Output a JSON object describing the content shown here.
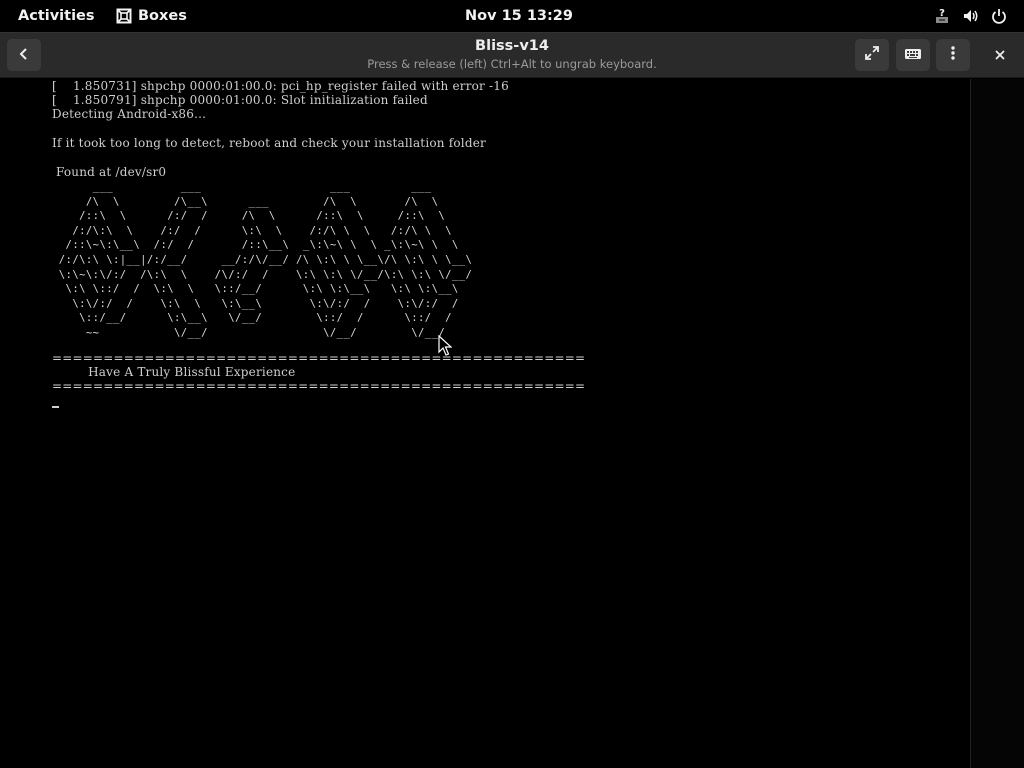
{
  "topbar": {
    "activities": "Activities",
    "app_name": "Boxes",
    "clock": "Nov 15  13:29",
    "icons": [
      "network-unknown-icon",
      "volume-icon",
      "power-icon"
    ]
  },
  "header": {
    "title": "Bliss-v14",
    "subtitle": "Press & release (left) Ctrl+Alt to ungrab keyboard.",
    "buttons": [
      "back-icon",
      "fullscreen-icon",
      "keyboard-icon",
      "menu-dots-icon",
      "close-icon"
    ]
  },
  "console": {
    "lines": [
      "[    1.850731] shpchp 0000:01:00.0: pci_hp_register failed with error -16",
      "[    1.850791] shpchp 0000:01:00.0: Slot initialization failed",
      "Detecting Android-x86...",
      "If it took too long to detect, reboot and check your installation folder",
      " Found at /dev/sr0",
      "====================================================",
      "         Have A Truly Blissful Experience",
      "===================================================="
    ],
    "ascii_art": "      ___          ___                   ___         ___\n     /\\  \\        /\\__\\      ___        /\\  \\       /\\  \\\n    /::\\  \\      /:/  /     /\\  \\      /::\\  \\     /::\\  \\\n   /:/\\:\\  \\    /:/  /      \\:\\  \\    /:/\\ \\  \\   /:/\\ \\  \\\n  /::\\~\\:\\__\\  /:/  /       /::\\__\\  _\\:\\~\\ \\  \\ _\\:\\~\\ \\  \\\n /:/\\:\\ \\:|__|/:/__/     __/:/\\/__/ /\\ \\:\\ \\ \\__\\/\\ \\:\\ \\ \\__\\\n \\:\\~\\:\\/:/  /\\:\\  \\    /\\/:/  /    \\:\\ \\:\\ \\/__/\\:\\ \\:\\ \\/__/\n  \\:\\ \\::/  /  \\:\\  \\   \\::/__/      \\:\\ \\:\\__\\   \\:\\ \\:\\__\\\n   \\:\\/:/  /    \\:\\  \\   \\:\\__\\       \\:\\/:/  /    \\:\\/:/  /\n    \\::/__/      \\:\\__\\   \\/__/        \\::/  /      \\::/  /\n     ~~           \\/__/                 \\/__/        \\/__/"
  }
}
